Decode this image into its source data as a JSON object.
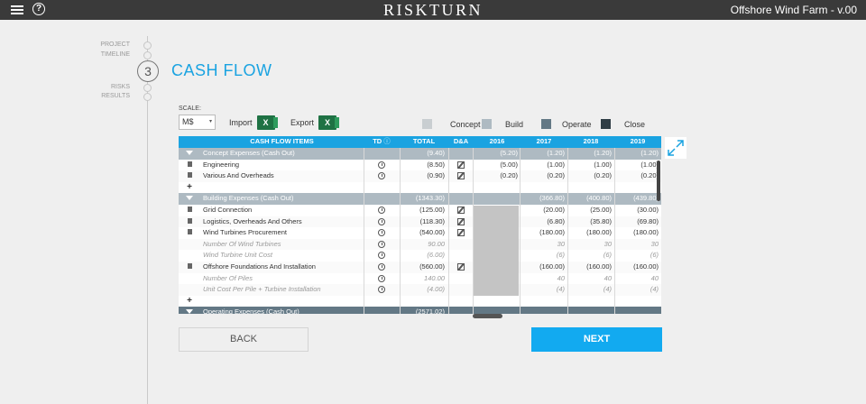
{
  "topbar": {
    "brand": "RISKTURN",
    "project": "Offshore Wind Farm - v.00",
    "help_glyph": "?"
  },
  "nav": {
    "items": [
      "PROJECT",
      "TIMELINE",
      "RISKS",
      "RESULTS"
    ],
    "step_number": "3"
  },
  "page": {
    "title": "CASH FLOW"
  },
  "toolbar": {
    "scale_label": "SCALE:",
    "scale_value": "M$",
    "import_label": "Import",
    "export_label": "Export",
    "excel_glyph": "X"
  },
  "legend": [
    {
      "label": "Concept",
      "color": "#c9ced1"
    },
    {
      "label": "Build",
      "color": "#aebac2"
    },
    {
      "label": "Operate",
      "color": "#637885"
    },
    {
      "label": "Close",
      "color": "#2f3d45"
    }
  ],
  "table": {
    "headers": [
      "CASH FLOW ITEMS",
      "TD",
      "TOTAL",
      "D&A",
      "2016",
      "2017",
      "2018",
      "2019"
    ],
    "rows": [
      {
        "type": "group",
        "name": "Concept Expenses (Cash Out)",
        "total": "(9.40)",
        "y2016": "(5.20)",
        "y2017": "(1.20)",
        "y2018": "(1.20)",
        "y2019": "(1.20)"
      },
      {
        "type": "item",
        "name": "Engineering",
        "total": "(8.50)",
        "y2016": "(5.00)",
        "y2017": "(1.00)",
        "y2018": "(1.00)",
        "y2019": "(1.00)"
      },
      {
        "type": "item",
        "name": "Various And Overheads",
        "total": "(0.90)",
        "y2016": "(0.20)",
        "y2017": "(0.20)",
        "y2018": "(0.20)",
        "y2019": "(0.20)"
      },
      {
        "type": "add"
      },
      {
        "type": "group",
        "name": "Building Expenses (Cash Out)",
        "total": "(1343.30)",
        "y2016": "",
        "y2017": "(366.80)",
        "y2018": "(400.80)",
        "y2019": "(439.80)"
      },
      {
        "type": "item",
        "name": "Grid Connection",
        "total": "(125.00)",
        "y2016": "",
        "y2017": "(20.00)",
        "y2018": "(25.00)",
        "y2019": "(30.00)"
      },
      {
        "type": "item",
        "name": "Logistics, Overheads And Others",
        "total": "(118.30)",
        "y2016": "",
        "y2017": "(6.80)",
        "y2018": "(35.80)",
        "y2019": "(69.80)"
      },
      {
        "type": "item",
        "name": "Wind Turbines Procurement",
        "total": "(540.00)",
        "y2016": "",
        "y2017": "(180.00)",
        "y2018": "(180.00)",
        "y2019": "(180.00)"
      },
      {
        "type": "sub",
        "name": "Number Of Wind Turbines",
        "total": "90.00",
        "y2016": "",
        "y2017": "30",
        "y2018": "30",
        "y2019": "30"
      },
      {
        "type": "sub",
        "name": "Wind Turbine Unit Cost",
        "total": "(6.00)",
        "y2016": "",
        "y2017": "(6)",
        "y2018": "(6)",
        "y2019": "(6)"
      },
      {
        "type": "item",
        "name": "Offshore Foundations And Installation",
        "total": "(560.00)",
        "y2016": "",
        "y2017": "(160.00)",
        "y2018": "(160.00)",
        "y2019": "(160.00)"
      },
      {
        "type": "sub",
        "name": "Number Of Piles",
        "total": "140.00",
        "y2016": "",
        "y2017": "40",
        "y2018": "40",
        "y2019": "40"
      },
      {
        "type": "sub",
        "name": "Unit Cost Per Pile + Turbine Installation",
        "total": "(4.00)",
        "y2016": "",
        "y2017": "(4)",
        "y2018": "(4)",
        "y2019": "(4)"
      },
      {
        "type": "add"
      },
      {
        "type": "group3",
        "name": "Operating Expenses (Cash Out)",
        "total": "(2571.02)",
        "y2016": "",
        "y2017": "",
        "y2018": "",
        "y2019": ""
      }
    ]
  },
  "buttons": {
    "back": "BACK",
    "next": "NEXT"
  }
}
